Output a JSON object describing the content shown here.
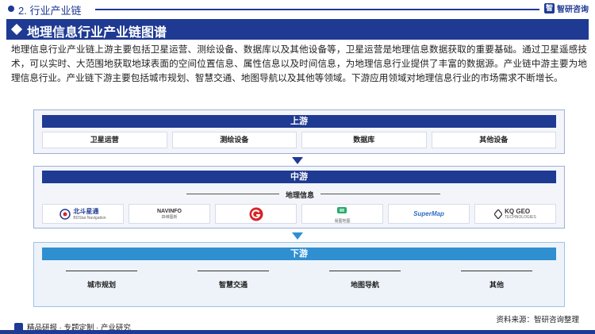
{
  "header": {
    "section_label": "2. 行业产业链",
    "brand_name": "智研咨询",
    "brand_mark": "智",
    "title": "地理信息行业产业链图谱"
  },
  "intro": "地理信息行业产业链上游主要包括卫星运营、测绘设备、数据库以及其他设备等，卫星运营是地理信息数据获取的重要基础。通过卫星遥感技术，可以实时、大范围地获取地球表面的空间位置信息、属性信息以及时间信息，为地理信息行业提供了丰富的数据源。产业链中游主要为地理信息行业。产业链下游主要包括城市规划、智慧交通、地图导航以及其他等领域。下游应用领域对地理信息行业的市场需求不断增长。",
  "upstream": {
    "title": "上游",
    "items": [
      "卫星运营",
      "测绘设备",
      "数据库",
      "其他设备"
    ]
  },
  "midstream": {
    "title": "中游",
    "subtitle": "地理信息",
    "logos": [
      {
        "name": "北斗星通",
        "sub": "BDStar Navigation",
        "icon": "bdstar-logo-icon"
      },
      {
        "name": "NAVINFO",
        "sub": "四维图新",
        "icon": "navinfo-logo-icon"
      },
      {
        "name": "",
        "sub": "",
        "icon": "red-g-logo-icon"
      },
      {
        "name": "",
        "sub": "易图地图",
        "icon": "green-map-logo-icon"
      },
      {
        "name": "SuperMap",
        "sub": "",
        "icon": "supermap-logo-icon"
      },
      {
        "name": "KQ GEO",
        "sub": "TECHNOLOGIES",
        "icon": "kqgeo-logo-icon"
      }
    ]
  },
  "downstream": {
    "title": "下游",
    "items": [
      "城市规划",
      "智慧交通",
      "地图导航",
      "其他"
    ]
  },
  "footer": {
    "slogan": "精品研报 · 专题定制 · 产业研究",
    "source": "资料来源：智研咨询整理"
  },
  "colors": {
    "primary": "#1f3a93",
    "downstream_accent": "#2f8fd1",
    "logo_red": "#d8232a",
    "logo_green": "#2aa96b"
  }
}
